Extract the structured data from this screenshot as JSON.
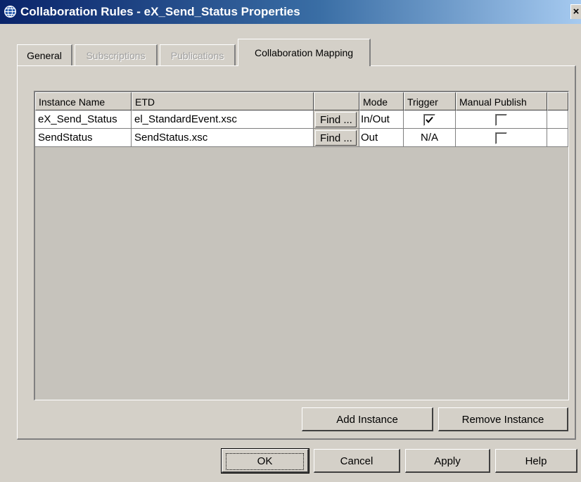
{
  "window": {
    "title": "Collaboration Rules - eX_Send_Status Properties",
    "close_label": "×",
    "icon": "globe-icon"
  },
  "tabs": [
    {
      "label": "General",
      "enabled": true
    },
    {
      "label": "Subscriptions",
      "enabled": false
    },
    {
      "label": "Publications",
      "enabled": false
    },
    {
      "label": "Collaboration Mapping",
      "enabled": true,
      "active": true
    }
  ],
  "table": {
    "columns": [
      "Instance Name",
      "ETD",
      "",
      "Mode",
      "Trigger",
      "Manual Publish",
      ""
    ],
    "rows": [
      {
        "instance_name": "eX_Send_Status",
        "etd": "el_StandardEvent.xsc",
        "find_label": "Find ...",
        "mode": "In/Out",
        "trigger": "checked",
        "manual_publish": false
      },
      {
        "instance_name": "SendStatus",
        "etd": "SendStatus.xsc",
        "find_label": "Find ...",
        "mode": "Out",
        "trigger": "N/A",
        "manual_publish": false
      }
    ]
  },
  "panel_buttons": {
    "add_instance": "Add Instance",
    "remove_instance": "Remove Instance"
  },
  "dialog_buttons": {
    "ok": "OK",
    "cancel": "Cancel",
    "apply": "Apply",
    "help": "Help"
  }
}
